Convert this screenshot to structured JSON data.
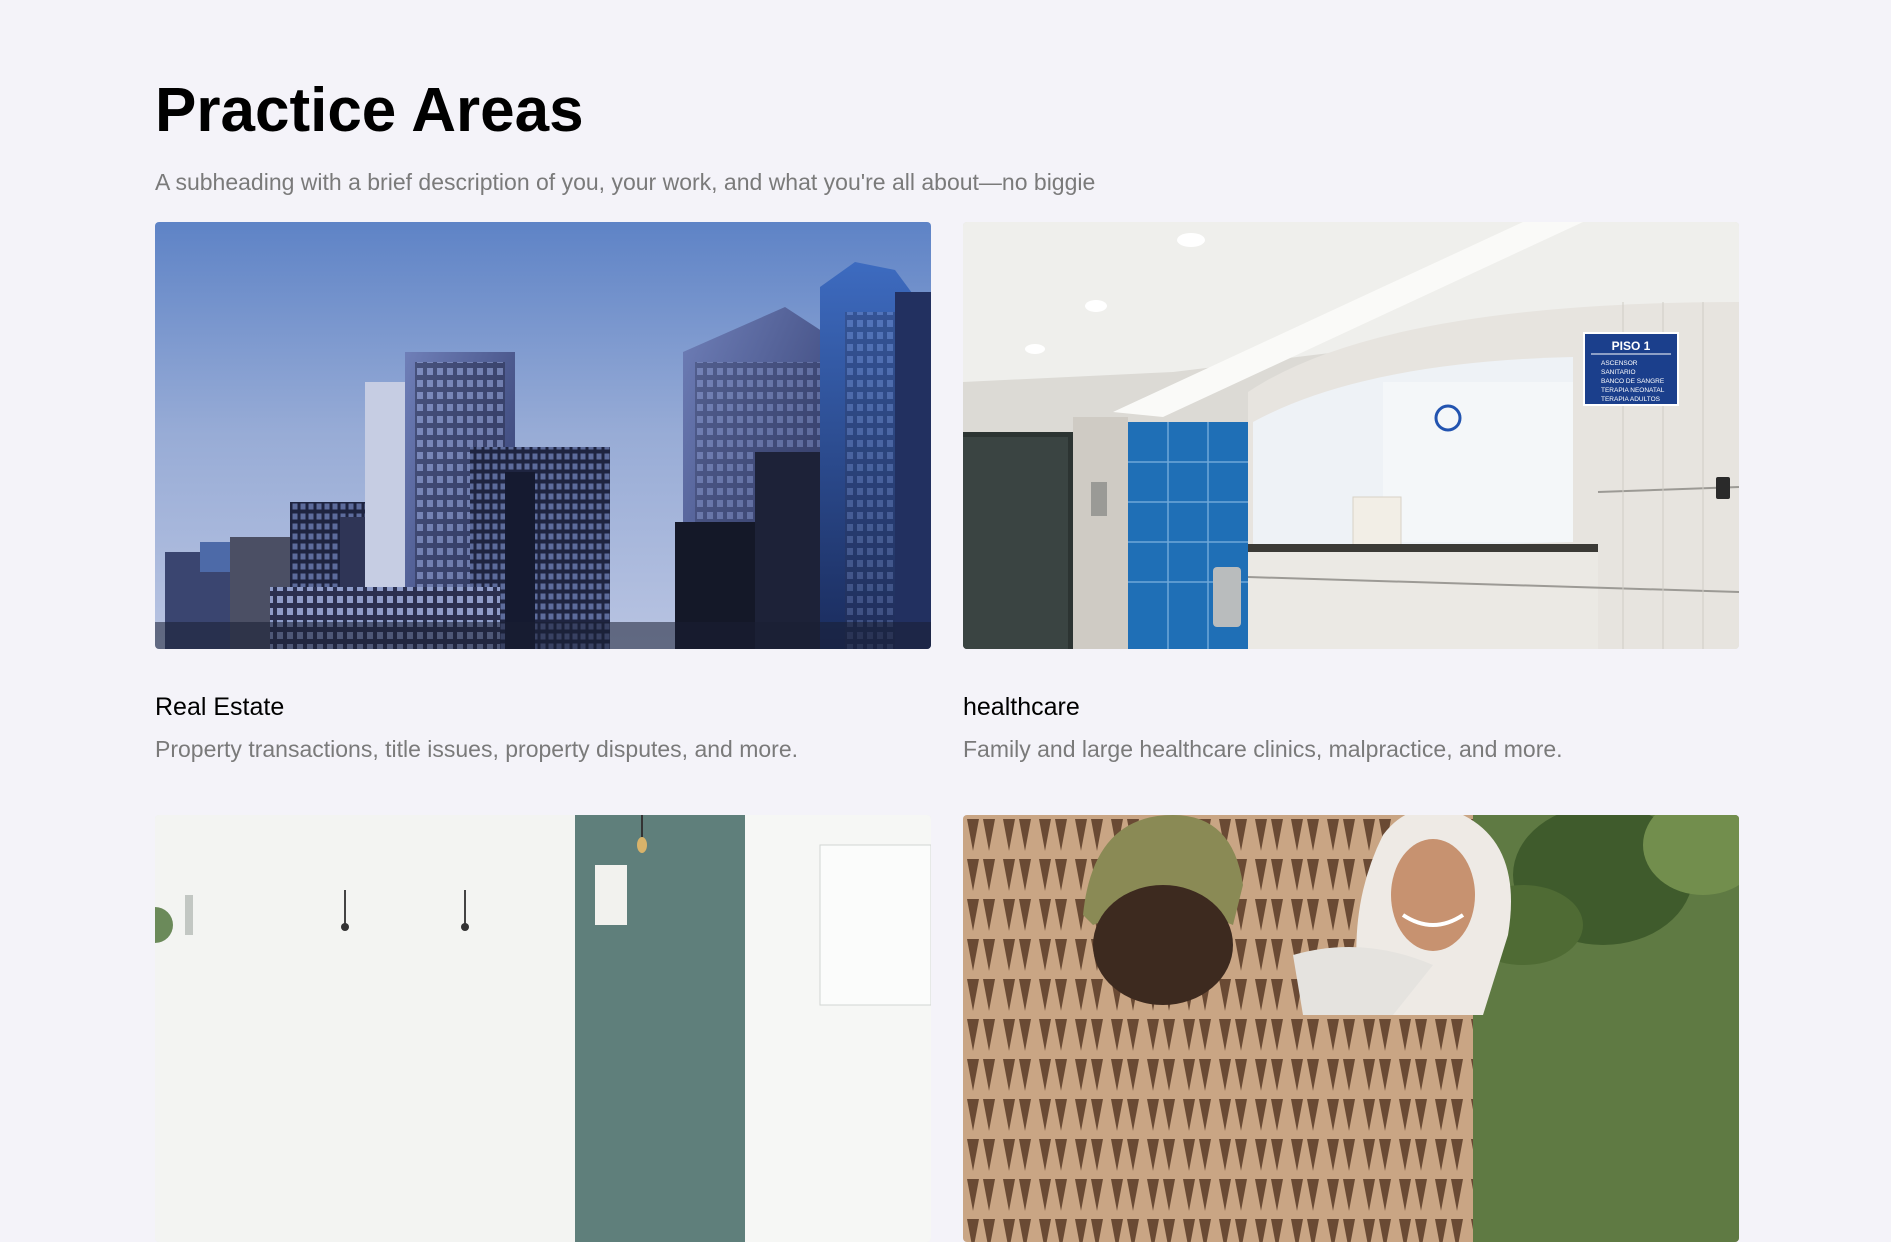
{
  "header": {
    "title": "Practice Areas",
    "subtitle": "A subheading with a brief description of you, your work, and what you're all about—no biggie"
  },
  "cards": [
    {
      "title": "Real Estate",
      "description": "Property transactions, title issues, property disputes, and more.",
      "image": "city-skyline-photo"
    },
    {
      "title": "healthcare",
      "description": "Family and large healthcare clinics, malpractice, and more.",
      "image": "hospital-reception-photo",
      "sign": {
        "heading": "PISO 1",
        "items": [
          "ASCENSOR",
          "SANITARIO",
          "BANCO DE SANGRE",
          "TERAPIA NEONATAL",
          "TERAPIA ADULTOS"
        ]
      }
    },
    {
      "image": "office-interior-photo"
    },
    {
      "image": "two-women-talking-photo"
    }
  ],
  "colors": {
    "background": "#f4f3f9",
    "heading": "#000000",
    "muted_text": "#7a7a7a"
  }
}
